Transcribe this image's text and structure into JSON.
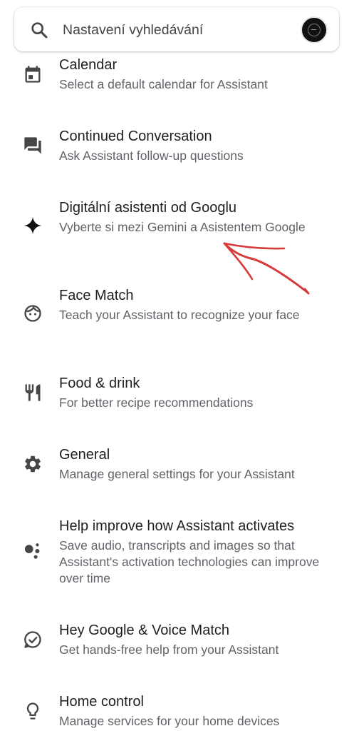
{
  "search": {
    "placeholder": "Nastavení vyhledávání",
    "search_icon": "search-icon",
    "avatar_icon": "account-avatar"
  },
  "settings": [
    {
      "icon": "calendar-icon",
      "title": "Calendar",
      "subtitle": "Select a default calendar for Assistant"
    },
    {
      "icon": "chat-icon",
      "title": "Continued Conversation",
      "subtitle": "Ask Assistant follow-up questions"
    },
    {
      "icon": "sparkle-icon",
      "title": "Digitální asistenti od Googlu",
      "subtitle": "Vyberte si mezi Gemini a Asistentem Google"
    },
    {
      "icon": "face-icon",
      "title": "Face Match",
      "subtitle": "Teach your Assistant to recognize your face"
    },
    {
      "icon": "restaurant-icon",
      "title": "Food & drink",
      "subtitle": "For better recipe recommendations"
    },
    {
      "icon": "gear-icon",
      "title": "General",
      "subtitle": "Manage general settings for your Assistant"
    },
    {
      "icon": "assistant-dots-icon",
      "title": "Help improve how Assistant activates",
      "subtitle": "Save audio, transcripts and images so that Assistant's activation technologies can improve over time"
    },
    {
      "icon": "voice-match-icon",
      "title": "Hey Google & Voice Match",
      "subtitle": "Get hands-free help from your Assistant"
    },
    {
      "icon": "lightbulb-icon",
      "title": "Home control",
      "subtitle": "Manage services for your home devices"
    }
  ],
  "colors": {
    "title": "#1f1f1f",
    "subtitle": "#5f6368",
    "icon": "#444746",
    "annotation_arrow": "#d63a3a"
  }
}
